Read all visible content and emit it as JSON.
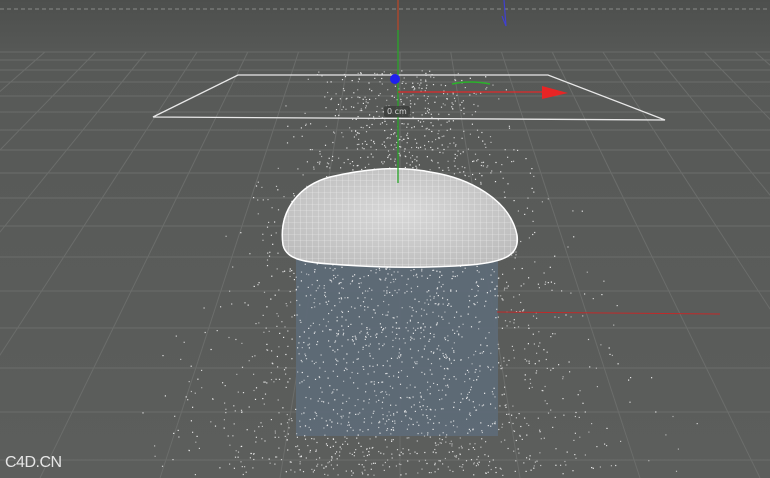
{
  "viewport": {
    "background": "#595b59",
    "far_background": "#4f514f",
    "grid_color": "#6b6d6b",
    "object_color": "#5f6b78"
  },
  "hud": {
    "distance_readout": "0 cm"
  },
  "axes": {
    "x_color": "#e02a2a",
    "y_color": "#2aa52a",
    "z_color": "#2a2ae0"
  },
  "icons": {
    "pivot": "axis-pivot-icon",
    "x_arrow": "x-axis-arrow-icon"
  },
  "watermark": {
    "text": "C4D.CN"
  }
}
